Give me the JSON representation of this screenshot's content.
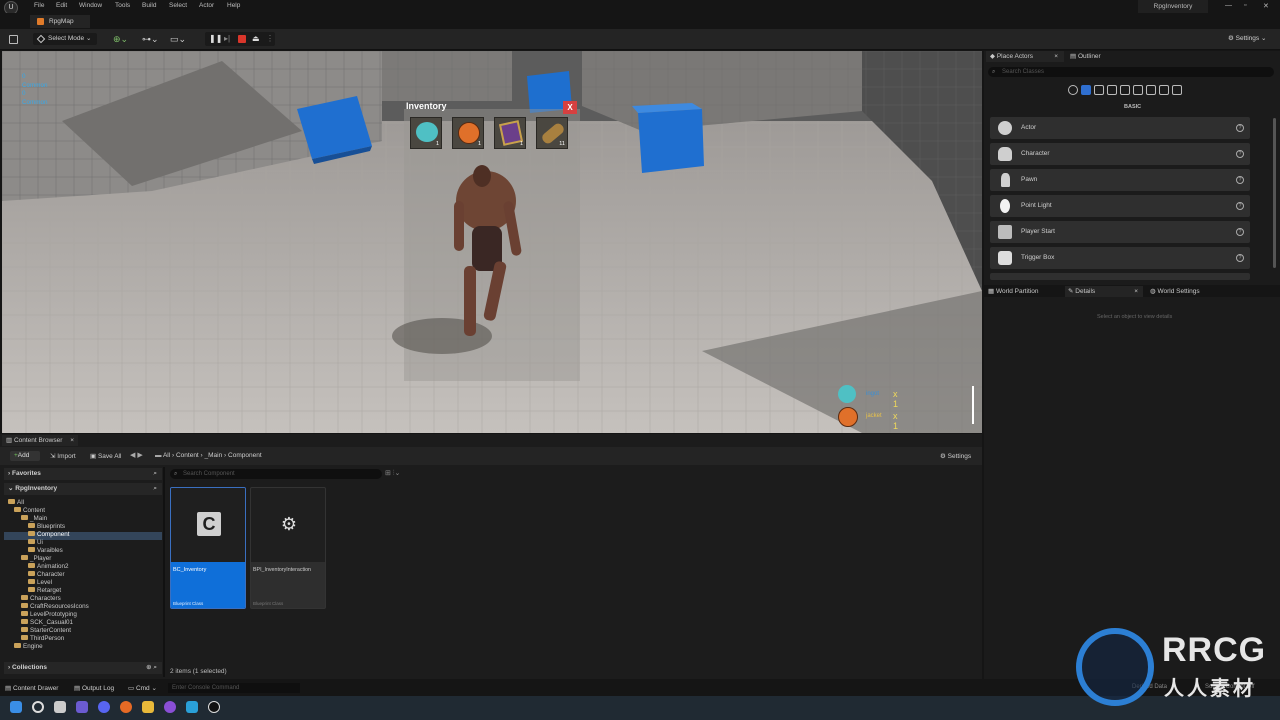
{
  "menu": {
    "logo": "U",
    "items": [
      "File",
      "Edit",
      "Window",
      "Tools",
      "Build",
      "Select",
      "Actor",
      "Help"
    ],
    "project_name": "RpgInventory",
    "win_min": "—",
    "win_max": "▫",
    "win_close": "✕"
  },
  "level_tab": {
    "label": "RpgMap"
  },
  "toolbar": {
    "select_mode": "Select Mode",
    "settings": "Settings",
    "colors": {
      "play": "#4d4d4d",
      "stop": "#d9362b"
    }
  },
  "viewport": {
    "debug_lines": [
      "0",
      "Common",
      "0",
      "Common"
    ],
    "inventory": {
      "title": "Inventory",
      "close": "X",
      "slots": [
        {
          "icon": "crystal-ball-icon",
          "count": "1"
        },
        {
          "icon": "basketball-icon",
          "count": "1"
        },
        {
          "icon": "magic-book-icon",
          "count": "1"
        },
        {
          "icon": "log-icon",
          "count": "11"
        }
      ]
    },
    "pickups": [
      {
        "icon": "crystal-ball-icon",
        "name": "ingot",
        "qty": "x 1"
      },
      {
        "icon": "basketball-icon",
        "name": "jacket",
        "qty": "x 1"
      }
    ]
  },
  "place_actors": {
    "tab": "Place Actors",
    "close": "×",
    "outliner_tab": "Outliner",
    "search_placeholder": "Search Classes",
    "category": "BASIC",
    "items": [
      {
        "label": "Actor",
        "icon": "sphere-icon"
      },
      {
        "label": "Character",
        "icon": "character-icon"
      },
      {
        "label": "Pawn",
        "icon": "pawn-icon"
      },
      {
        "label": "Point Light",
        "icon": "light-bulb-icon"
      },
      {
        "label": "Player Start",
        "icon": "flag-icon"
      },
      {
        "label": "Trigger Box",
        "icon": "cube-icon"
      }
    ],
    "help": "?"
  },
  "details": {
    "world_partition_tab": "World Partition",
    "details_tab": "Details",
    "close": "×",
    "world_settings_tab": "World Settings",
    "empty_message": "Select an object to view details"
  },
  "content_browser": {
    "tab": "Content Browser",
    "close": "×",
    "add": "Add",
    "import": "Import",
    "save_all": "Save All",
    "breadcrumb": [
      "All",
      "Content",
      "_Main",
      "Component"
    ],
    "settings": "Settings",
    "favorites": "Favorites",
    "project": "RpgInventory",
    "search_placeholder": "Search Component",
    "collections": "Collections",
    "tree": [
      "All",
      "Content",
      "_Main",
      "Blueprints",
      "Component",
      "Ui",
      "Varaibles",
      "_Player",
      "Animation2",
      "Character",
      "Level",
      "Retarget",
      "Characters",
      "CraftResourcesIcons",
      "LevelPrototyping",
      "SCK_Casual01",
      "StarterContent",
      "ThirdPerson",
      "Engine"
    ],
    "assets": [
      {
        "name": "BC_Inventory",
        "type": "Blueprint Class",
        "glyph": "C",
        "selected": true
      },
      {
        "name": "BPI_InventoryInteraction",
        "type": "Blueprint Class",
        "glyph": "⚙",
        "selected": false
      }
    ],
    "status": "2 items (1 selected)"
  },
  "statusbar": {
    "content_drawer": "Content Drawer",
    "output_log": "Output Log",
    "cmd": "Cmd",
    "console_placeholder": "Enter Console Command",
    "derived_data": "Derived Data",
    "source_control": "Source Control Off"
  },
  "watermark": {
    "brand": "RRCG",
    "sub": "人人素材"
  }
}
